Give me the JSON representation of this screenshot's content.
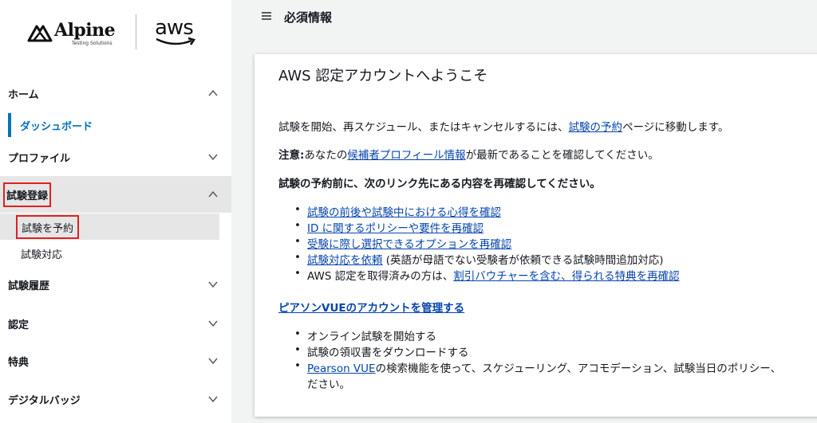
{
  "brand": {
    "alpine_name": "Alpine",
    "alpine_sub": "Testing Solutions",
    "aws_name": "aws"
  },
  "sidebar": {
    "items": [
      {
        "label": "ホーム"
      },
      {
        "label": "プロファイル"
      },
      {
        "label": "試験登録"
      },
      {
        "label": "試験履歴"
      },
      {
        "label": "認定"
      },
      {
        "label": "特典"
      },
      {
        "label": "デジタルバッジ"
      }
    ],
    "home_sub": {
      "dashboard": "ダッシュボード"
    },
    "exam_sub": {
      "reserve": "試験を予約",
      "response": "試験対応"
    }
  },
  "header": {
    "title": "必須情報"
  },
  "main": {
    "title": "AWS 認定アカウントへようこそ",
    "p1": {
      "pre": "試験を開始、再スケジュール、またはキャンセルするには、",
      "link": "試験の予約",
      "post": "ページに移動します。"
    },
    "p2": {
      "bold": "注意:",
      "pre": "あなたの",
      "link": "候補者プロフィール情報",
      "post": "が最新であることを確認してください。"
    },
    "p3": "試験の予約前に、次のリンク先にある内容を再確認してください。",
    "list1": [
      {
        "link": "試験の前後や試験中における心得を確認",
        "post": ""
      },
      {
        "link": "ID に関するポリシーや要件を再確認",
        "post": ""
      },
      {
        "link": "受験に際し選択できるオプションを再確認",
        "post": ""
      },
      {
        "link": "試験対応を依頼",
        "post": " (英語が母語でない受験者が依頼できる試験時間追加対応)"
      },
      {
        "pre": "AWS 認定を取得済みの方は、",
        "link": "割引バウチャーを含む、得られる特典を再確認"
      }
    ],
    "pearson_link": "ピアソンVUEのアカウントを管理する",
    "list2": [
      "オンライン試験を開始する",
      "試験の領収書をダウンロードする"
    ],
    "list2_last": {
      "link": "Pearson VUE",
      "post": "の検索機能を使って、スケジューリング、アコモデーション、試験当日のポリシー、",
      "line2": "ださい。"
    }
  },
  "colors": {
    "link": "#0645ad",
    "accent": "#0073bb",
    "highlight": "#e02121"
  }
}
